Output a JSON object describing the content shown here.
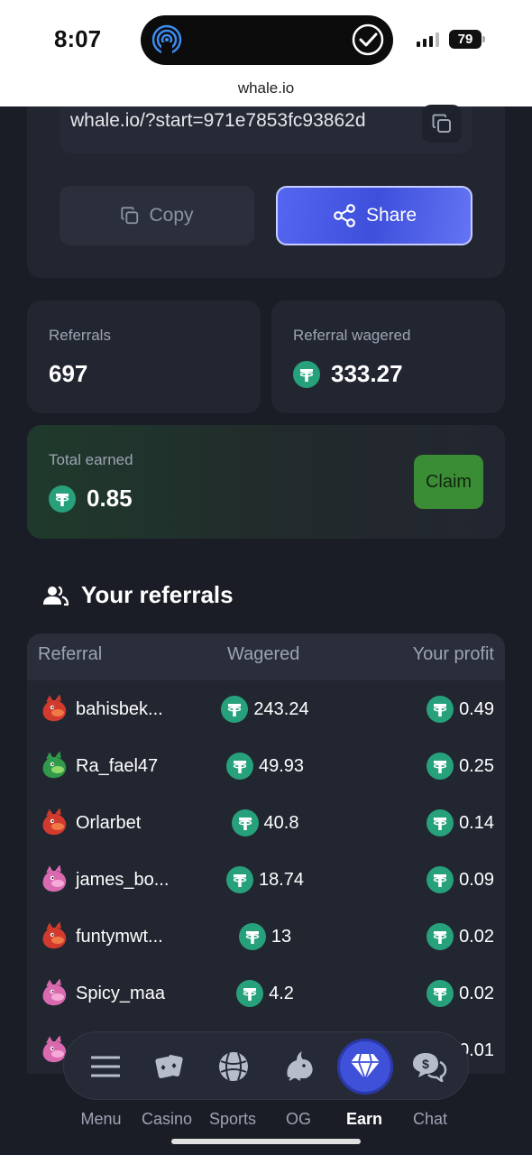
{
  "status_bar": {
    "time": "8:07",
    "battery": "79"
  },
  "browser": {
    "url": "whale.io"
  },
  "referral_link": {
    "link": "whale.io/?start=971e7853fc93862d"
  },
  "actions": {
    "copy_label": "Copy",
    "share_label": "Share"
  },
  "stats": {
    "referrals_label": "Referrals",
    "referrals_value": "697",
    "wagered_label": "Referral wagered",
    "wagered_value": "333.27"
  },
  "earned": {
    "label": "Total earned",
    "value": "0.85",
    "claim_label": "Claim"
  },
  "section": {
    "title": "Your referrals",
    "icon": "users-icon"
  },
  "table": {
    "headers": [
      "Referral",
      "Wagered",
      "Your profit"
    ],
    "rows": [
      {
        "name": "bahisbek...",
        "wagered": "243.24",
        "profit": "0.49",
        "avatar": "red-dragon"
      },
      {
        "name": "Ra_fael47",
        "wagered": "49.93",
        "profit": "0.25",
        "avatar": "green-dragon"
      },
      {
        "name": "Orlarbet",
        "wagered": "40.8",
        "profit": "0.14",
        "avatar": "red-dragon"
      },
      {
        "name": "james_bo...",
        "wagered": "18.74",
        "profit": "0.09",
        "avatar": "pink-dragon"
      },
      {
        "name": "funtymwt...",
        "wagered": "13",
        "profit": "0.02",
        "avatar": "red-dragon"
      },
      {
        "name": "Spicy_maa",
        "wagered": "4.2",
        "profit": "0.02",
        "avatar": "pink-dragon"
      },
      {
        "name": "",
        "wagered": "",
        "profit": "0.01",
        "avatar": "pink-dragon"
      }
    ]
  },
  "nav": {
    "items": [
      {
        "label": "Menu",
        "icon": "hamburger-icon"
      },
      {
        "label": "Casino",
        "icon": "cards-icon"
      },
      {
        "label": "Sports",
        "icon": "ball-icon"
      },
      {
        "label": "OG",
        "icon": "whale-icon"
      },
      {
        "label": "Earn",
        "icon": "diamond-icon"
      },
      {
        "label": "Chat",
        "icon": "chat-icon"
      }
    ],
    "active": "Earn"
  },
  "colors": {
    "accent": "#4356e0",
    "tether": "#26a17b",
    "claim": "#3b8d35",
    "bg": "#1a1d26",
    "card": "#222631"
  }
}
